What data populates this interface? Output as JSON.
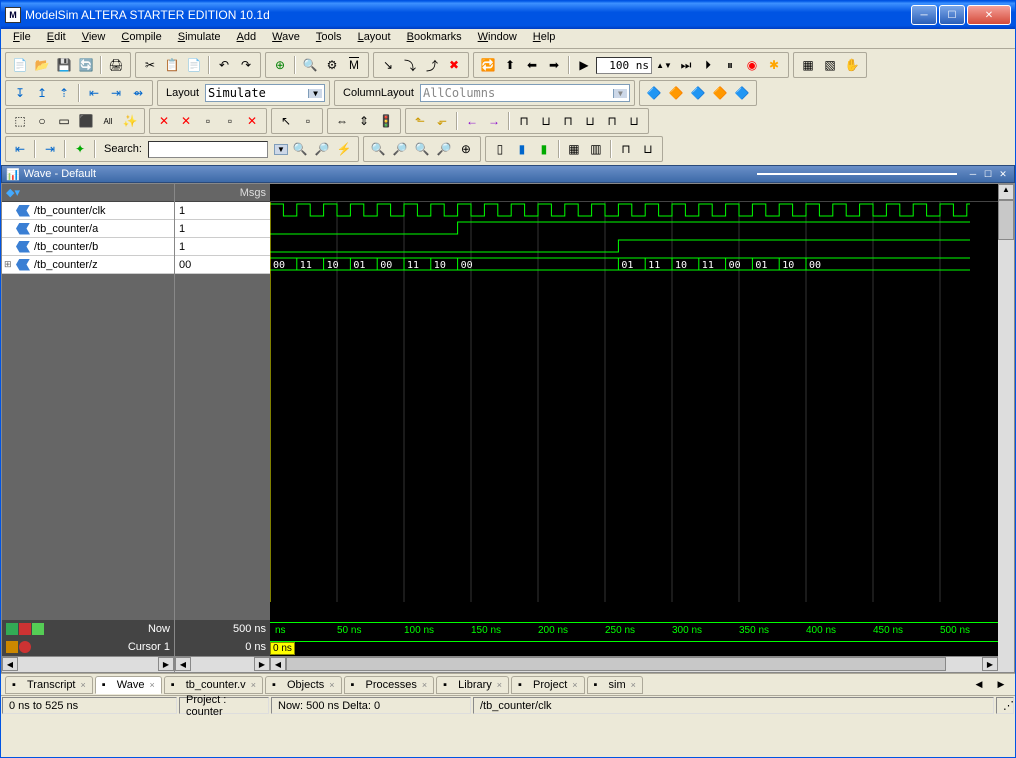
{
  "window": {
    "title": "ModelSim ALTERA STARTER EDITION 10.1d",
    "icon_letter": "M"
  },
  "menu": [
    "File",
    "Edit",
    "View",
    "Compile",
    "Simulate",
    "Add",
    "Wave",
    "Tools",
    "Layout",
    "Bookmarks",
    "Window",
    "Help"
  ],
  "toolbar": {
    "layout_label": "Layout",
    "layout_value": "Simulate",
    "collayout_label": "ColumnLayout",
    "collayout_value": "AllColumns",
    "time_value": "100 ns",
    "search_label": "Search:",
    "search_value": ""
  },
  "wave_panel": {
    "title": "Wave - Default",
    "msgs_header": "Msgs",
    "signals": [
      {
        "name": "/tb_counter/clk",
        "value": "1",
        "expandable": false
      },
      {
        "name": "/tb_counter/a",
        "value": "1",
        "expandable": false
      },
      {
        "name": "/tb_counter/b",
        "value": "1",
        "expandable": false
      },
      {
        "name": "/tb_counter/z",
        "value": "00",
        "expandable": true
      }
    ],
    "now_label": "Now",
    "now_value": "500 ns",
    "cursor_label": "Cursor 1",
    "cursor_value": "0 ns",
    "cursor_marker": "0 ns",
    "ruler_ticks": [
      {
        "pos": 5,
        "label": "ns"
      },
      {
        "pos": 67,
        "label": "50 ns"
      },
      {
        "pos": 134,
        "label": "100 ns"
      },
      {
        "pos": 201,
        "label": "150 ns"
      },
      {
        "pos": 268,
        "label": "200 ns"
      },
      {
        "pos": 335,
        "label": "250 ns"
      },
      {
        "pos": 402,
        "label": "300 ns"
      },
      {
        "pos": 469,
        "label": "350 ns"
      },
      {
        "pos": 536,
        "label": "400 ns"
      },
      {
        "pos": 603,
        "label": "450 ns"
      },
      {
        "pos": 670,
        "label": "500 ns"
      }
    ],
    "bus_values": [
      "00",
      "11",
      "10",
      "01",
      "00",
      "11",
      "10",
      "00",
      "",
      "",
      "",
      "",
      "01",
      "11",
      "10",
      "11",
      "00",
      "01",
      "10",
      "00"
    ]
  },
  "tabs": [
    {
      "label": "Transcript",
      "icon": "transcript-icon"
    },
    {
      "label": "Wave",
      "icon": "wave-icon",
      "active": true
    },
    {
      "label": "tb_counter.v",
      "icon": "file-icon"
    },
    {
      "label": "Objects",
      "icon": "objects-icon"
    },
    {
      "label": "Processes",
      "icon": "processes-icon"
    },
    {
      "label": "Library",
      "icon": "library-icon"
    },
    {
      "label": "Project",
      "icon": "project-icon"
    },
    {
      "label": "sim",
      "icon": "sim-icon"
    }
  ],
  "status": {
    "range": "0 ns to 525 ns",
    "project": "Project : counter",
    "now": "Now: 500 ns  Delta: 0",
    "selected": "/tb_counter/clk"
  },
  "chart_data": {
    "type": "waveform",
    "time_range_ns": [
      0,
      525
    ],
    "clock_period_ns": 20,
    "signals": [
      {
        "name": "/tb_counter/clk",
        "type": "clock",
        "period_ns": 20,
        "duty": 0.5
      },
      {
        "name": "/tb_counter/a",
        "type": "bit",
        "transitions_ns": [
          [
            0,
            0
          ],
          [
            140,
            1
          ]
        ]
      },
      {
        "name": "/tb_counter/b",
        "type": "bit",
        "transitions_ns": [
          [
            0,
            0
          ],
          [
            260,
            1
          ]
        ]
      },
      {
        "name": "/tb_counter/z",
        "type": "bus",
        "width": 2,
        "samples_ns": [
          [
            0,
            "00"
          ],
          [
            20,
            "11"
          ],
          [
            40,
            "10"
          ],
          [
            60,
            "01"
          ],
          [
            80,
            "00"
          ],
          [
            100,
            "11"
          ],
          [
            120,
            "10"
          ],
          [
            140,
            "00"
          ],
          [
            260,
            "01"
          ],
          [
            280,
            "11"
          ],
          [
            300,
            "10"
          ],
          [
            320,
            "11"
          ],
          [
            340,
            "00"
          ],
          [
            360,
            "01"
          ],
          [
            380,
            "10"
          ],
          [
            400,
            "00"
          ]
        ]
      }
    ]
  }
}
